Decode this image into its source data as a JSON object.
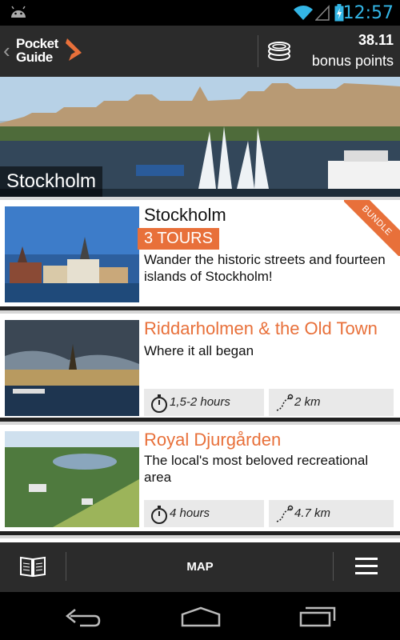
{
  "status_bar": {
    "time": "12:57"
  },
  "header": {
    "logo_line1": "Pocket",
    "logo_line2": "Guide",
    "points_value": "38.11",
    "points_label": "bonus points"
  },
  "banner": {
    "caption": "Stockholm"
  },
  "cards": [
    {
      "title": "Stockholm",
      "badge": "3 TOURS",
      "ribbon": "BUNDLE",
      "description": "Wander the historic streets and fourteen islands of Stockholm!"
    },
    {
      "title": "Riddarholmen & the Old Town",
      "description": "Where it all began",
      "duration": "1,5-2 hours",
      "distance": "2 km"
    },
    {
      "title": "Royal Djurgården",
      "description": "The local's most beloved recreational area",
      "duration": "4 hours",
      "distance": "4.7 km"
    }
  ],
  "bottom_bar": {
    "map_label": "MAP"
  },
  "colors": {
    "accent": "#e8703a",
    "status_blue": "#33b5e5",
    "bar_bg": "#2b2b2b"
  }
}
